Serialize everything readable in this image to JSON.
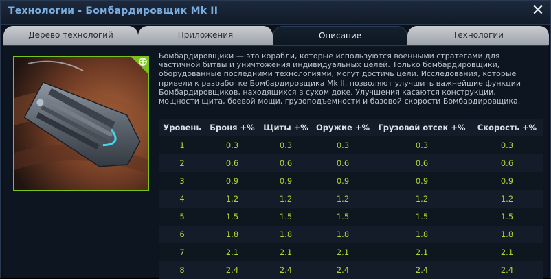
{
  "window": {
    "title": "Технологии - Бомбардировщик Mk II",
    "close_glyph": "✕"
  },
  "tabs": [
    {
      "label": "Дерево технологий",
      "active": false
    },
    {
      "label": "Приложения",
      "active": false
    },
    {
      "label": "Описание",
      "active": true
    },
    {
      "label": "Технологии",
      "active": false
    }
  ],
  "portrait": {
    "badge_icon": "bomber-class-icon",
    "badge_color": "#7ac21c"
  },
  "description": "Бомбардировщики — это корабли, которые используются военными стратегами для частичной битвы и уничтожения индивидуальных целей. Только бомбардировщики, оборудованные последними технологиями, могут достичь цели. Исследования, которые привели к разработке Бомбардировщика Mk II, позволяют улучшить важнейшие функции Бомбардировщиков, находящихся в сухом доке. Улучшения касаются конструкции, мощности щита, боевой мощи, грузоподъемности и базовой скорости Бомбардировщика.",
  "table": {
    "headers": [
      "Уровень",
      "Броня +%",
      "Щиты +%",
      "Оружие +%",
      "Грузовой отсек +%",
      "Скорость +%"
    ],
    "rows": [
      [
        "1",
        "0.3",
        "0.3",
        "0.3",
        "0.3",
        "0.3"
      ],
      [
        "2",
        "0.6",
        "0.6",
        "0.6",
        "0.6",
        "0.6"
      ],
      [
        "3",
        "0.9",
        "0.9",
        "0.9",
        "0.9",
        "0.9"
      ],
      [
        "4",
        "1.2",
        "1.2",
        "1.2",
        "1.2",
        "1.2"
      ],
      [
        "5",
        "1.5",
        "1.5",
        "1.5",
        "1.5",
        "1.5"
      ],
      [
        "6",
        "1.8",
        "1.8",
        "1.8",
        "1.8",
        "1.8"
      ],
      [
        "7",
        "2.1",
        "2.1",
        "2.1",
        "2.1",
        "2.1"
      ],
      [
        "8",
        "2.4",
        "2.4",
        "2.4",
        "2.4",
        "2.4"
      ]
    ],
    "value_color": "#a8d632"
  }
}
